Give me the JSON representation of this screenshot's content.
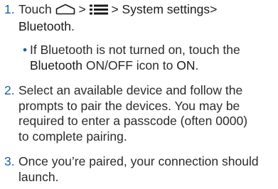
{
  "steps": [
    {
      "number": "1.",
      "part_touch": "Touch",
      "sep1": ">",
      "sep2": ">",
      "menu_settings": "System settings",
      "sep3": ">",
      "menu_bluetooth": "Bluetooth",
      "period": ".",
      "home_icon": "home-icon",
      "menu_icon": "menu-icon"
    },
    {
      "number": "2.",
      "lines": [
        "Select an available device and follow the",
        "prompts to pair the devices. You may be",
        "required to enter a passcode (often 0000)",
        "to complete pairing."
      ]
    },
    {
      "number": "3.",
      "lines": [
        "Once you’re paired, your connection should",
        "launch."
      ]
    }
  ],
  "bullet": {
    "marker": "•",
    "line1": "If Bluetooth is not turned on, touch the",
    "line2_bold1": "Bluetooth",
    "line2_mid": "ON/OFF icon to",
    "line2_bold2": "ON",
    "line2_end": "."
  },
  "colors": {
    "accent": "#1f5fa8",
    "text": "#2b2b2b"
  }
}
